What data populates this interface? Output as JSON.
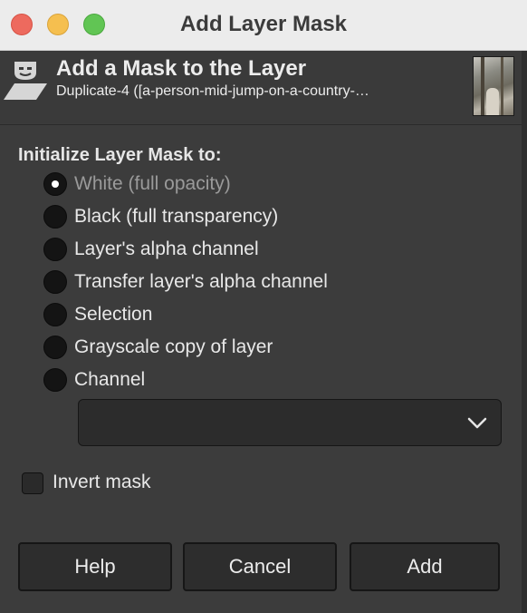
{
  "window": {
    "title": "Add Layer Mask"
  },
  "header": {
    "title": "Add a Mask to the Layer",
    "subtitle": "Duplicate-4 ([a-person-mid-jump-on-a-country-…",
    "icon": "layer-mask-icon",
    "thumbnail": "layer-thumbnail"
  },
  "init": {
    "label": "Initialize Layer Mask to:",
    "options": [
      {
        "label": "White (full opacity)",
        "checked": true,
        "dimmed": true
      },
      {
        "label": "Black (full transparency)",
        "checked": false
      },
      {
        "label": "Layer's alpha channel",
        "checked": false
      },
      {
        "label": "Transfer layer's alpha channel",
        "checked": false
      },
      {
        "label": "Selection",
        "checked": false
      },
      {
        "label": "Grayscale copy of layer",
        "checked": false
      },
      {
        "label": "Channel",
        "checked": false
      }
    ],
    "channel_select": {
      "value": "",
      "icon": "chevron-down-icon"
    }
  },
  "invert": {
    "label": "Invert mask",
    "checked": false
  },
  "buttons": {
    "help": "Help",
    "cancel": "Cancel",
    "add": "Add"
  },
  "colors": {
    "background": "#3c3c3c",
    "titlebar": "#ececec",
    "close": "#ed6a5e",
    "minimize": "#f5bf4f",
    "maximize": "#61c554"
  }
}
